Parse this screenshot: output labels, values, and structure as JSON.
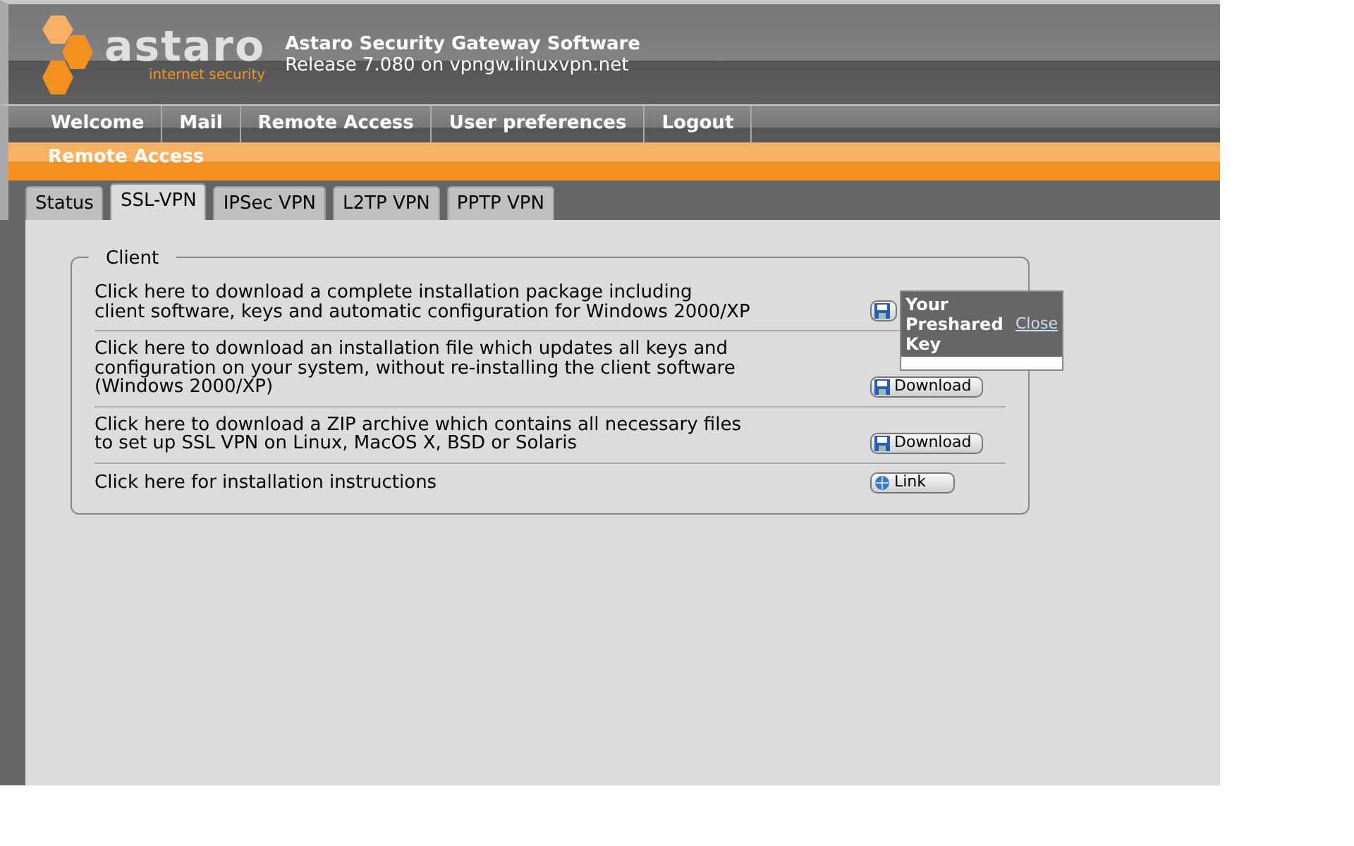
{
  "header": {
    "logo": {
      "wordmark": "astaro",
      "tagline": "internet security"
    },
    "title": "Astaro Security Gateway Software",
    "subtitle": "Release 7.080 on vpngw.linuxvpn.net"
  },
  "menu": [
    {
      "label": "Welcome"
    },
    {
      "label": "Mail"
    },
    {
      "label": "Remote Access"
    },
    {
      "label": "User preferences"
    },
    {
      "label": "Logout"
    }
  ],
  "section_title": "Remote Access",
  "tabs": [
    {
      "label": "Status",
      "selected": false
    },
    {
      "label": "SSL-VPN",
      "selected": true
    },
    {
      "label": "IPSec VPN",
      "selected": false
    },
    {
      "label": "L2TP VPN",
      "selected": false
    },
    {
      "label": "PPTP VPN",
      "selected": false
    }
  ],
  "client_panel": {
    "legend": "Client",
    "rows": [
      {
        "text": "Click here to download a complete installation package including\nclient software, keys and automatic configuration for Windows 2000/XP",
        "button": {
          "kind": "download"
        }
      },
      {
        "text": "Click here to download an installation file which updates all keys and\nconfiguration on your system, without re-installing the client software\n(Windows 2000/XP)",
        "button": {
          "kind": "download",
          "label": "Download"
        }
      },
      {
        "text": "Click here to download a ZIP archive which contains all necessary files\nto set up SSL VPN on Linux, MacOS X, BSD or Solaris",
        "button": {
          "kind": "download",
          "label": "Download"
        }
      },
      {
        "text": "Click here for installation instructions",
        "button": {
          "kind": "link",
          "label": "Link"
        }
      }
    ]
  },
  "popup": {
    "title": "Your Preshared Key",
    "close": "Close"
  }
}
